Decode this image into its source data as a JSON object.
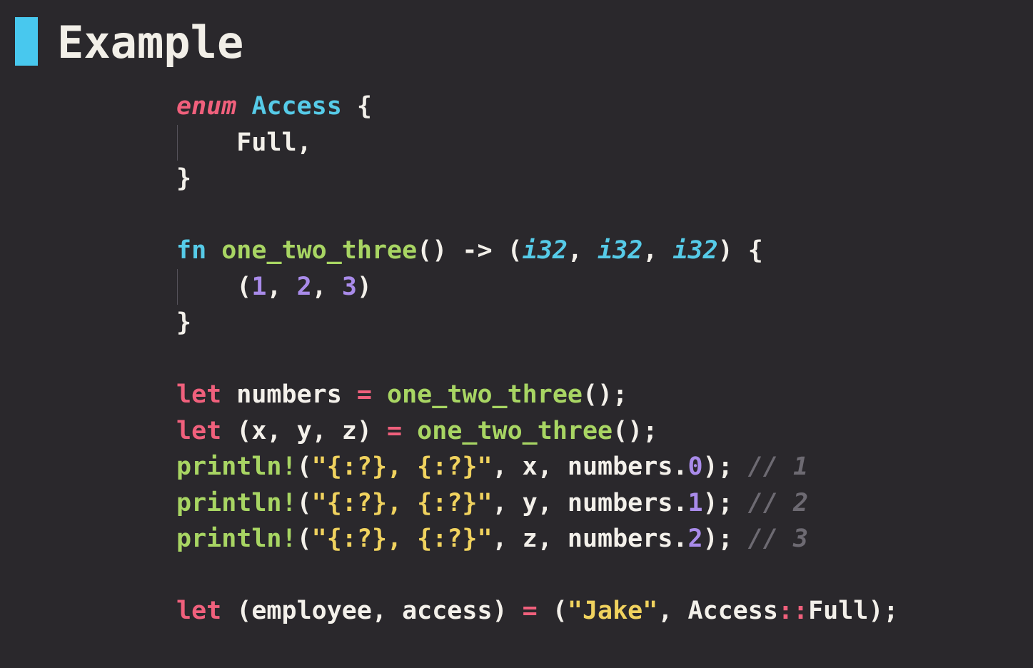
{
  "title": "Example",
  "colors": {
    "background": "#2a282c",
    "accent_bar": "#48c8ee",
    "keyword": "#f0607c",
    "type": "#56cbe8",
    "function": "#a8d563",
    "number": "#a98bea",
    "string": "#f0d25e",
    "comment": "#6d6a72",
    "plain": "#f3f0ea"
  },
  "code": {
    "l1": [
      "enum",
      " ",
      "Access",
      " {"
    ],
    "l2": [
      "    Full,"
    ],
    "l3": [
      "}"
    ],
    "l4": [
      ""
    ],
    "l5": [
      "fn",
      " ",
      "one_two_three",
      "() -> (",
      "i32",
      ", ",
      "i32",
      ", ",
      "i32",
      ") {"
    ],
    "l6": [
      "    (",
      "1",
      ", ",
      "2",
      ", ",
      "3",
      ")"
    ],
    "l7": [
      "}"
    ],
    "l8": [
      ""
    ],
    "l9": [
      "let",
      " numbers ",
      "=",
      " ",
      "one_two_three",
      "();"
    ],
    "l10": [
      "let",
      " (x, y, z) ",
      "=",
      " ",
      "one_two_three",
      "();"
    ],
    "l11": [
      "println!",
      "(",
      "\"{:?}, {:?}\"",
      ", x, numbers.",
      "0",
      "); ",
      "// 1"
    ],
    "l12": [
      "println!",
      "(",
      "\"{:?}, {:?}\"",
      ", y, numbers.",
      "1",
      "); ",
      "// 2"
    ],
    "l13": [
      "println!",
      "(",
      "\"{:?}, {:?}\"",
      ", z, numbers.",
      "2",
      "); ",
      "// 3"
    ],
    "l14": [
      ""
    ],
    "l15": [
      "let",
      " (employee, access) ",
      "=",
      " (",
      "\"Jake\"",
      ", Access",
      "::",
      "Full);"
    ]
  }
}
